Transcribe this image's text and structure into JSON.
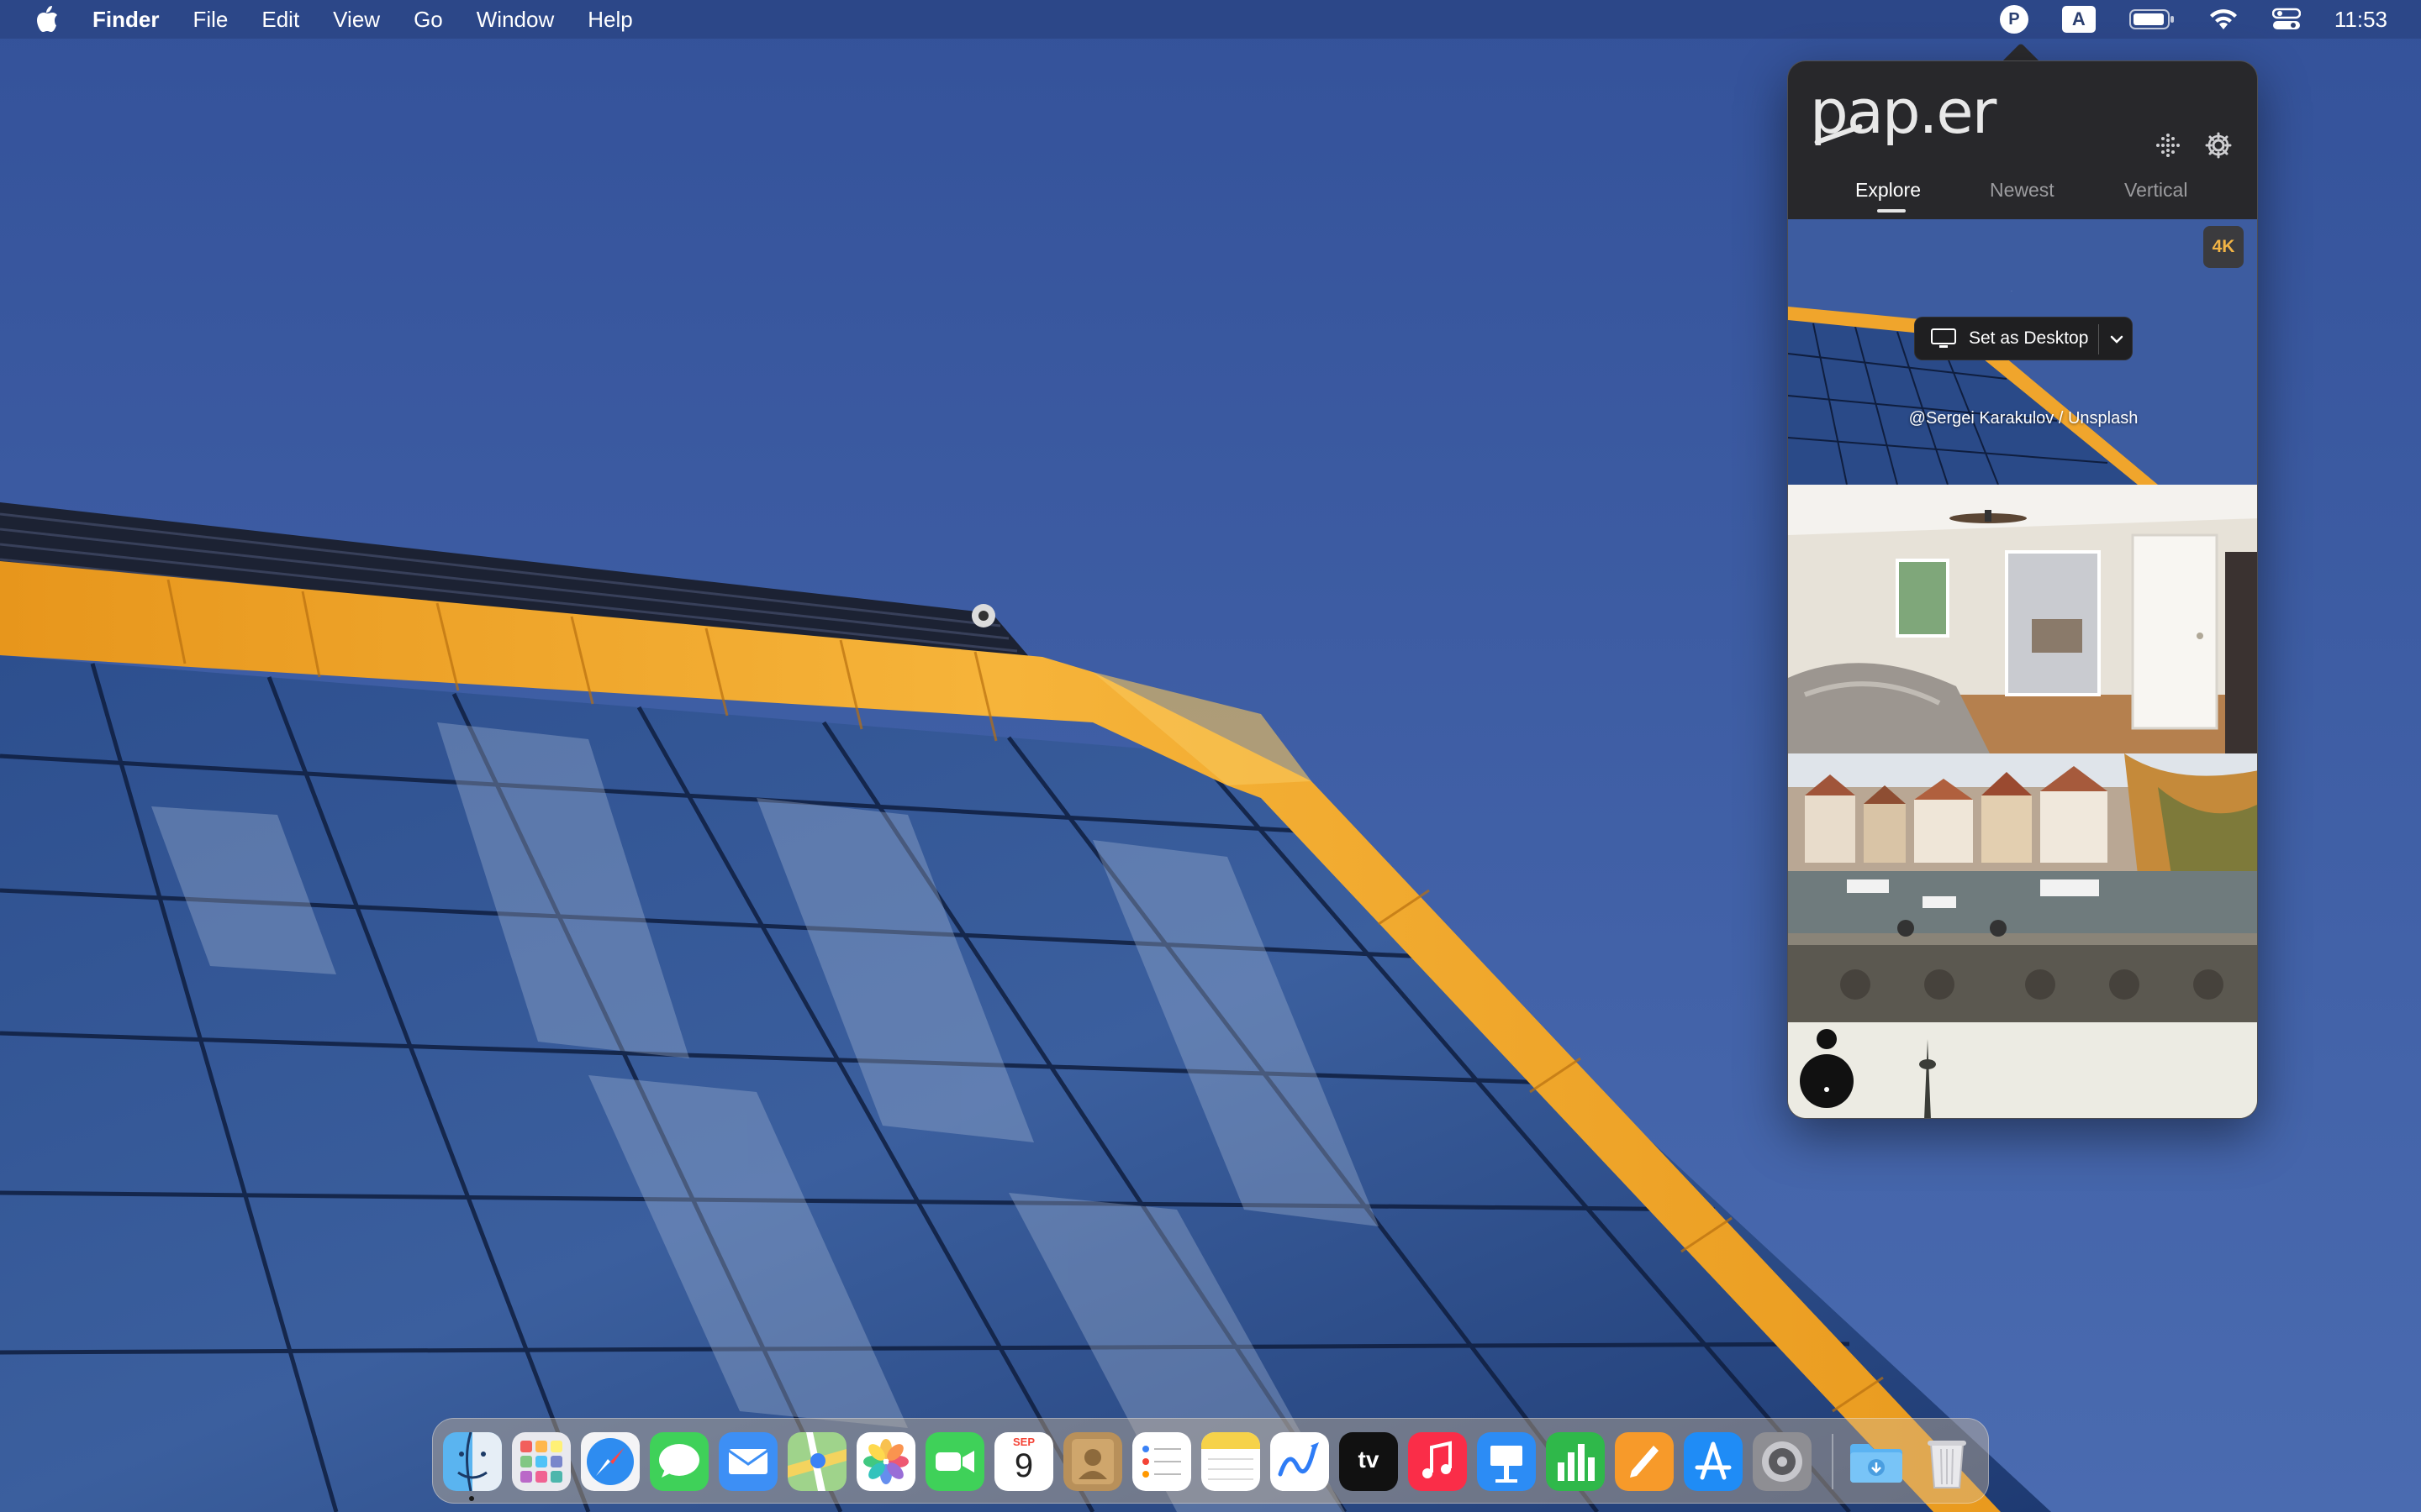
{
  "menubar": {
    "apple_icon": "apple-logo-icon",
    "app_name": "Finder",
    "items": [
      "File",
      "Edit",
      "View",
      "Go",
      "Window",
      "Help"
    ],
    "status_icons": [
      "paper-app-icon",
      "input-source-icon",
      "battery-icon",
      "wifi-icon",
      "control-center-icon"
    ],
    "input_source_label": "A",
    "paper_icon_label": "P",
    "clock": "11:53"
  },
  "popover": {
    "logo": "pap.er",
    "icons": [
      "wallpaper-grid-icon",
      "settings-gear-icon"
    ],
    "tabs": [
      {
        "label": "Explore",
        "active": true
      },
      {
        "label": "Newest",
        "active": false
      },
      {
        "label": "Vertical",
        "active": false
      }
    ],
    "featured": {
      "badge": "4K",
      "set_desktop_label": "Set as Desktop",
      "credit": "@Sergei Karakulov / Unsplash"
    },
    "thumbnails": [
      "building-with-moon",
      "bright-bedroom",
      "riverside-town-bridge",
      "tower-skyline"
    ]
  },
  "dock": {
    "apps": [
      "Finder",
      "Launchpad",
      "Safari",
      "Messages",
      "Mail",
      "Maps",
      "Photos",
      "FaceTime",
      "Calendar",
      "Contacts",
      "Reminders",
      "Notes",
      "Freeform",
      "TV",
      "Music",
      "Keynote",
      "Numbers",
      "Pages",
      "App Store",
      "System Settings",
      "Downloads",
      "Trash"
    ],
    "calendar_month": "SEP",
    "calendar_day": "9",
    "tv_label": "tv"
  },
  "colors": {
    "sky": "#3d5ea0",
    "accent_orange": "#f2a329",
    "popover_bg": "#28282b",
    "badge_text": "#f2b445"
  }
}
